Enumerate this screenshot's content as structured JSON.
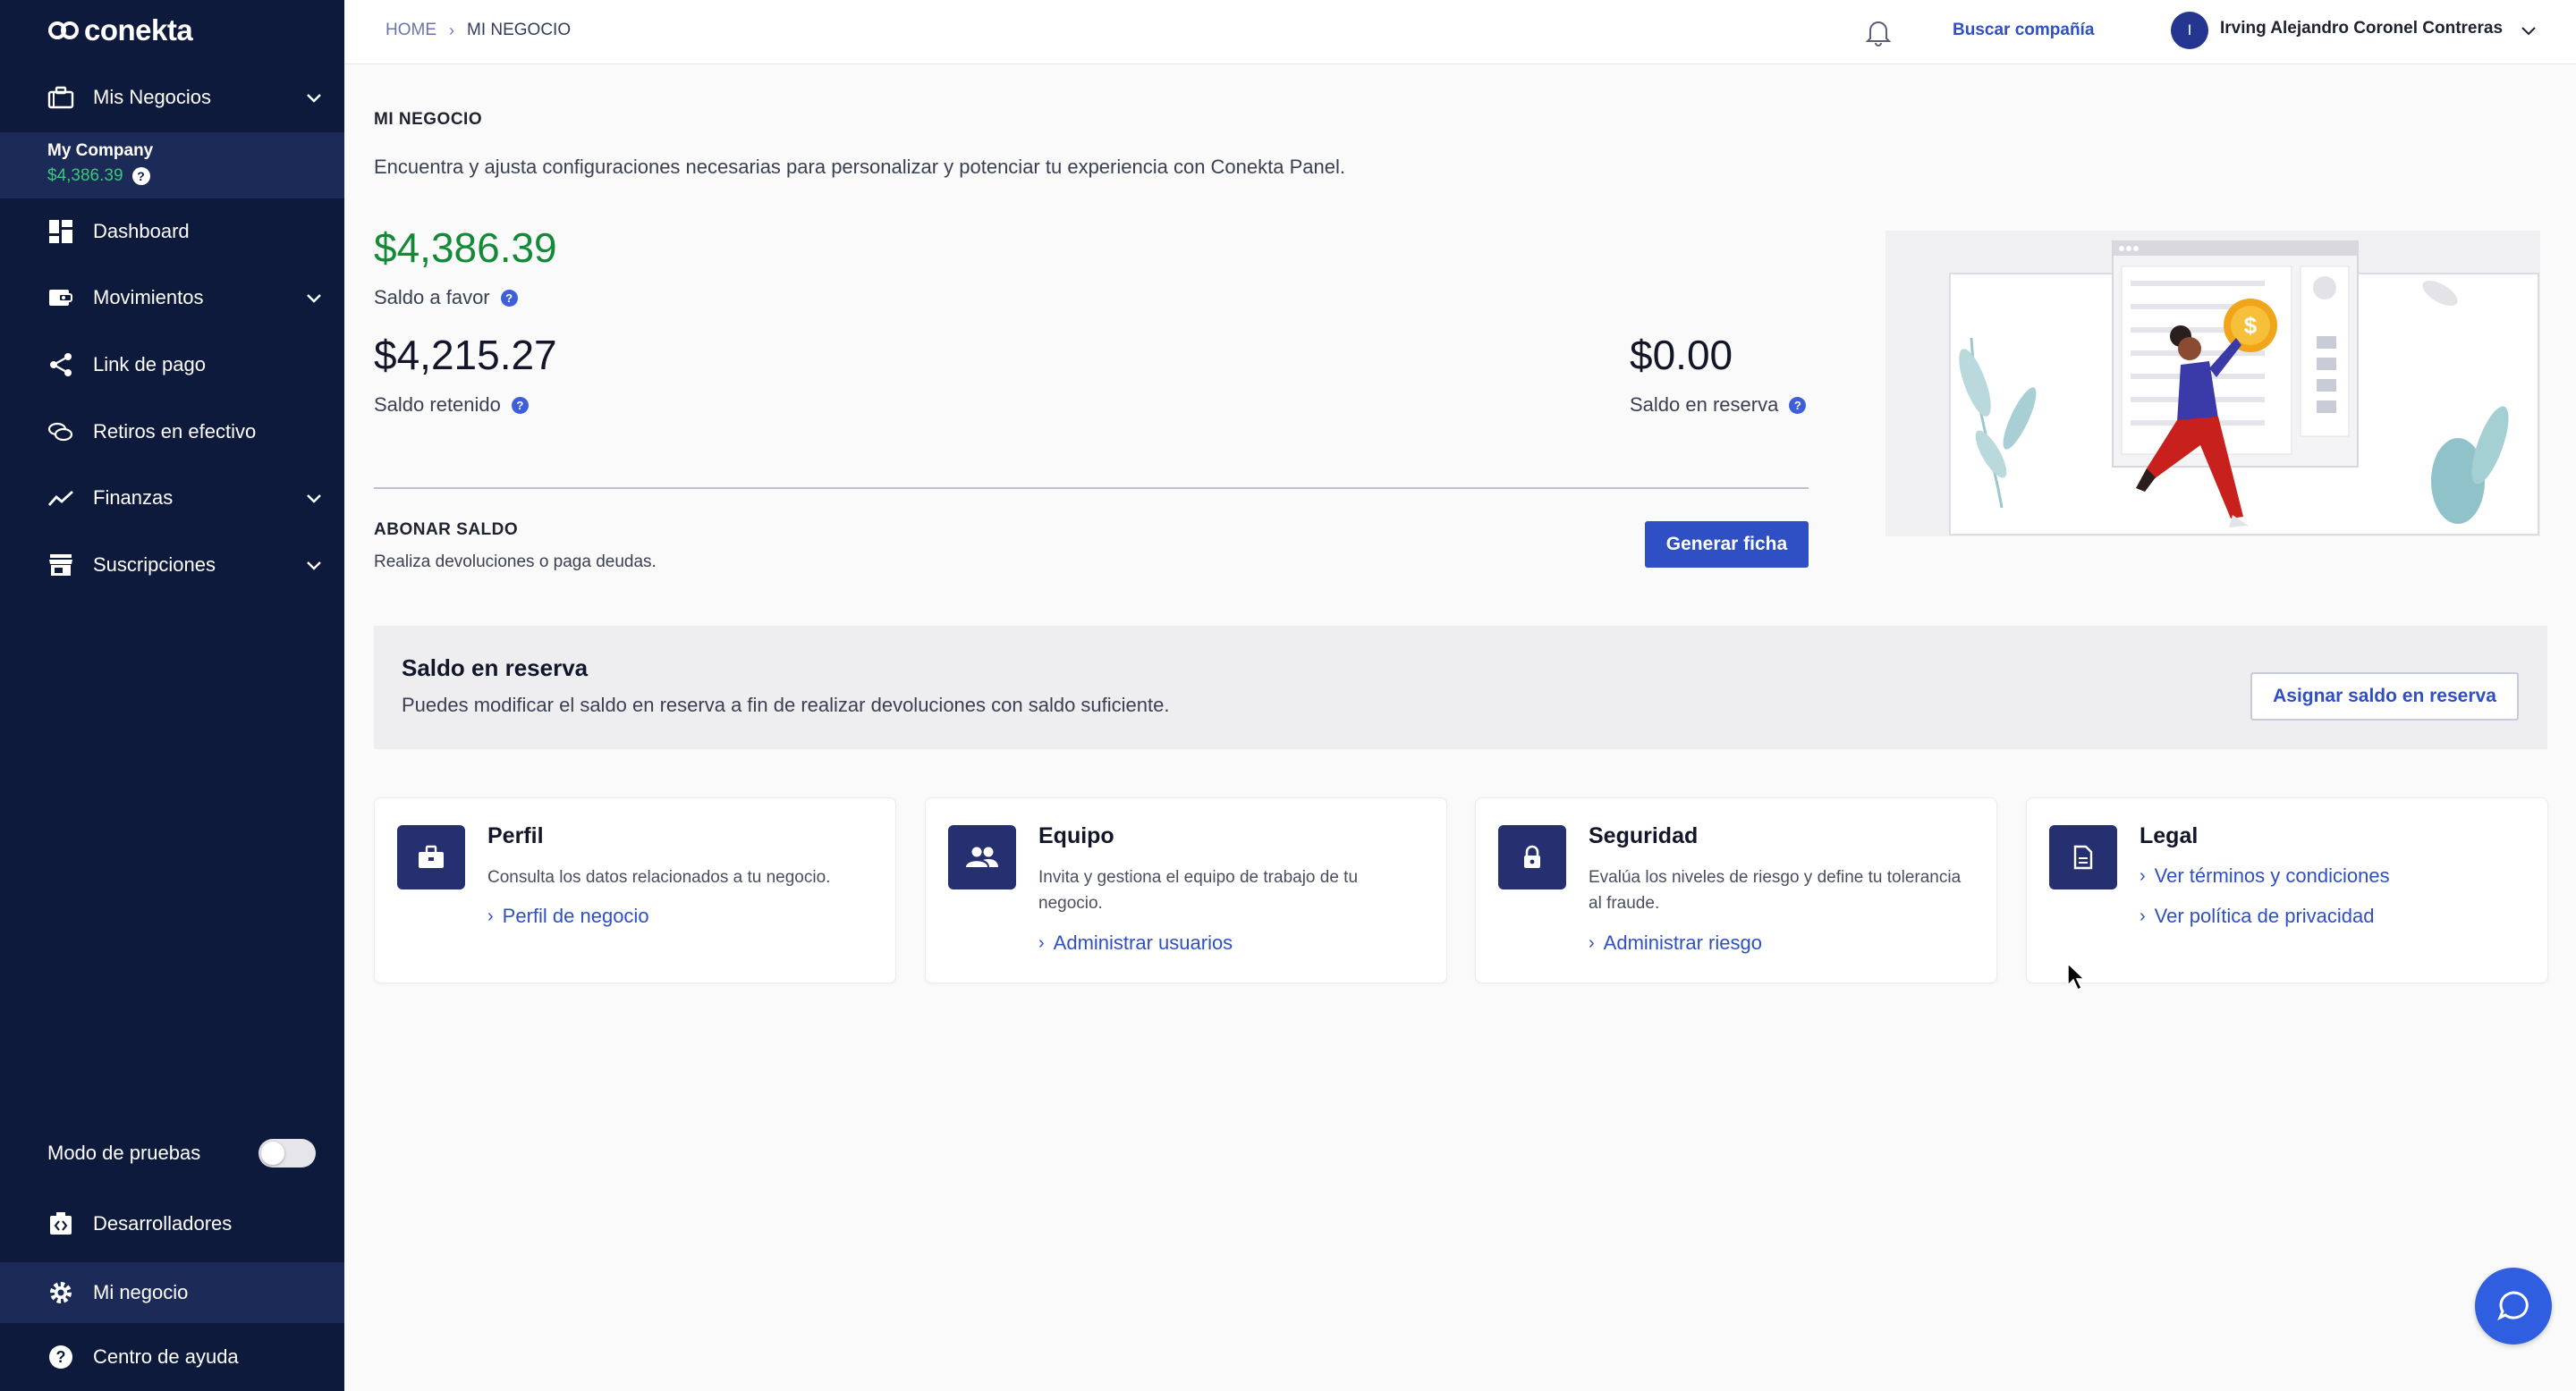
{
  "colors": {
    "sidebar": "#0d1a3c",
    "sidebar_active": "#1b2a56",
    "accent": "#2f4fc4",
    "positive": "#138a36",
    "card_icon": "#263070"
  },
  "brand": {
    "name": "conekta"
  },
  "sidebar": {
    "business_menu": {
      "label": "Mis Negocios",
      "icon": "briefcase-icon"
    },
    "company": {
      "name": "My Company",
      "balance": "$4,386.39"
    },
    "items": [
      {
        "label": "Dashboard",
        "icon": "dashboard-icon",
        "expandable": false
      },
      {
        "label": "Movimientos",
        "icon": "wallet-icon",
        "expandable": true
      },
      {
        "label": "Link de pago",
        "icon": "share-icon",
        "expandable": false
      },
      {
        "label": "Retiros en efectivo",
        "icon": "coins-icon",
        "expandable": false
      },
      {
        "label": "Finanzas",
        "icon": "trend-icon",
        "expandable": true
      },
      {
        "label": "Suscripciones",
        "icon": "store-icon",
        "expandable": true
      }
    ],
    "test_mode": {
      "label": "Modo de pruebas",
      "enabled": false
    },
    "bottom_items": [
      {
        "label": "Desarrolladores",
        "icon": "developers-icon",
        "active": false
      },
      {
        "label": "Mi negocio",
        "icon": "gear-icon",
        "active": true
      },
      {
        "label": "Centro de ayuda",
        "icon": "help-icon",
        "active": false
      }
    ]
  },
  "topbar": {
    "breadcrumb": {
      "home": "HOME",
      "current": "MI NEGOCIO"
    },
    "search_company": "Buscar compañía",
    "user": {
      "initial": "I",
      "name": "Irving Alejandro Coronel Contreras"
    }
  },
  "main": {
    "title": "MI NEGOCIO",
    "description": "Encuentra y ajusta configuraciones necesarias para personalizar y potenciar tu experiencia con Conekta Panel.",
    "balance_favor": {
      "value": "$4,386.39",
      "label": "Saldo a favor"
    },
    "balance_retained": {
      "value": "$4,215.27",
      "label": "Saldo retenido"
    },
    "balance_reserve": {
      "value": "$0.00",
      "label": "Saldo en reserva"
    },
    "abonar": {
      "title": "ABONAR SALDO",
      "description": "Realiza devoluciones o paga deudas.",
      "button": "Generar ficha"
    },
    "reserve_section": {
      "title": "Saldo en reserva",
      "description": "Puedes modificar el saldo en reserva a fin de realizar devoluciones con saldo suficiente.",
      "button": "Asignar saldo en reserva"
    },
    "cards": [
      {
        "title": "Perfil",
        "icon": "briefcase-icon",
        "description": "Consulta los datos relacionados a tu negocio.",
        "links": [
          "Perfil de negocio"
        ]
      },
      {
        "title": "Equipo",
        "icon": "team-icon",
        "description": "Invita y gestiona el equipo de trabajo de tu negocio.",
        "links": [
          "Administrar usuarios"
        ]
      },
      {
        "title": "Seguridad",
        "icon": "lock-icon",
        "description": "Evalúa los niveles de riesgo y define tu tolerancia al fraude.",
        "links": [
          "Administrar riesgo"
        ]
      },
      {
        "title": "Legal",
        "icon": "document-icon",
        "description": "",
        "links": [
          "Ver términos y condiciones",
          "Ver política de privacidad"
        ]
      }
    ]
  }
}
